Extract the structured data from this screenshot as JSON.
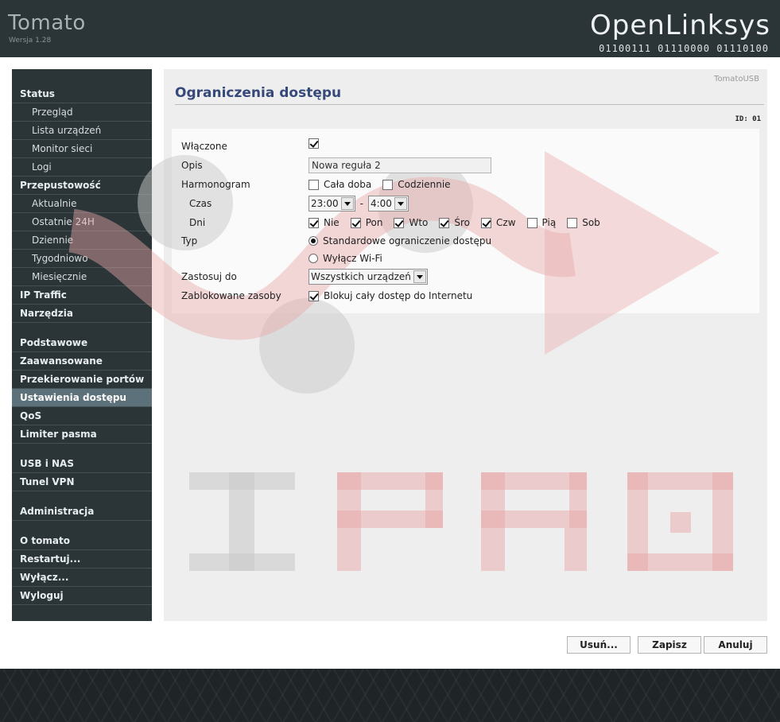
{
  "header": {
    "title": "Tomato",
    "version": "Wersja 1.28",
    "logo": "OpenLinksys",
    "logo_binary": "01100111 01110000 01110100"
  },
  "sidebar": {
    "items": [
      {
        "label": "Status"
      },
      {
        "label": "Przegląd"
      },
      {
        "label": "Lista urządzeń"
      },
      {
        "label": "Monitor sieci"
      },
      {
        "label": "Logi"
      },
      {
        "label": "Przepustowość"
      },
      {
        "label": "Aktualnie"
      },
      {
        "label": "Ostatnie 24H"
      },
      {
        "label": "Dziennie"
      },
      {
        "label": "Tygodniowo"
      },
      {
        "label": "Miesięcznie"
      },
      {
        "label": "IP Traffic"
      },
      {
        "label": "Narzędzia"
      },
      {
        "label": "Podstawowe"
      },
      {
        "label": "Zaawansowane"
      },
      {
        "label": "Przekierowanie portów"
      },
      {
        "label": "Ustawienia dostępu"
      },
      {
        "label": "QoS"
      },
      {
        "label": "Limiter pasma"
      },
      {
        "label": "USB i NAS"
      },
      {
        "label": "Tunel VPN"
      },
      {
        "label": "Administracja"
      },
      {
        "label": "O tomato"
      },
      {
        "label": "Restartuj..."
      },
      {
        "label": "Wyłącz..."
      },
      {
        "label": "Wyloguj"
      }
    ],
    "active": "Ustawienia dostępu"
  },
  "content": {
    "tomatousb": "TomatoUSB",
    "title": "Ograniczenia dostępu",
    "rule_id": "ID: 01"
  },
  "form": {
    "enabled_label": "Włączone",
    "enabled": true,
    "desc_label": "Opis",
    "desc_value": "Nowa reguła 2",
    "schedule_label": "Harmonogram",
    "all_day_label": "Cała doba",
    "all_day": false,
    "everyday_label": "Codziennie",
    "everyday": false,
    "time_label": "Czas",
    "time_from": "23:00",
    "time_sep": "-",
    "time_to": "4:00",
    "days_label": "Dni",
    "days": [
      {
        "label": "Nie",
        "checked": true
      },
      {
        "label": "Pon",
        "checked": true
      },
      {
        "label": "Wto",
        "checked": true
      },
      {
        "label": "Śro",
        "checked": true
      },
      {
        "label": "Czw",
        "checked": true
      },
      {
        "label": "Pią",
        "checked": false
      },
      {
        "label": "Sob",
        "checked": false
      }
    ],
    "type_label": "Typ",
    "type_standard": "Standardowe ograniczenie dostępu",
    "type_wifi": "Wyłącz Wi-Fi",
    "type_selected": "standard",
    "apply_label": "Zastosuj do",
    "apply_value": "Wszystkich urządzeń",
    "blocked_label": "Zablokowane zasoby",
    "block_all_label": "Blokuj cały dostęp do Internetu",
    "block_all": true
  },
  "buttons": {
    "delete": "Usuń...",
    "save": "Zapisz",
    "cancel": "Anuluj"
  },
  "colors": {
    "header_bg": "#2b3437",
    "sidebar_active": "#5c7179",
    "title": "#36497a",
    "watermark_red": "#e8a8a8",
    "watermark_gray": "#cccccc"
  }
}
